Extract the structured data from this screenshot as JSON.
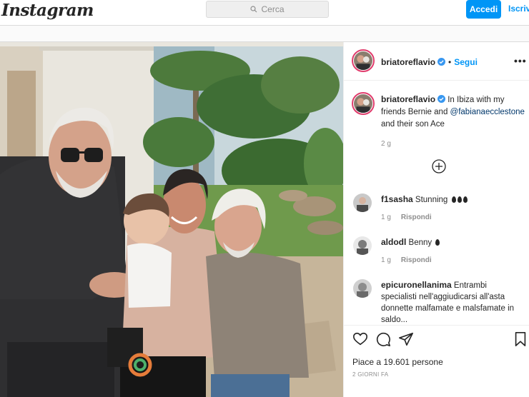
{
  "nav": {
    "logo": "Instagram",
    "search_placeholder": "Cerca",
    "login_label": "Accedi",
    "signup_label": "Iscriviti"
  },
  "post": {
    "author": "briatoreflavio",
    "dot": "•",
    "follow_label": "Segui",
    "more_label": "•••",
    "caption_text_before": "In Ibiza with my friends Bernie and ",
    "caption_tag": "@fabianaecclestone",
    "caption_text_after": " and their son Ace",
    "caption_age": "2 g",
    "comments": [
      {
        "user": "f1sasha",
        "text": "Stunning",
        "age": "1 g",
        "reply": "Rispondi"
      },
      {
        "user": "aldodl",
        "text": "Benny",
        "age": "1 g",
        "reply": "Rispondi"
      },
      {
        "user": "epicuronellanima",
        "text": "Entrambi specialisti nell'aggiudicarsi all'asta donnette malfamate e malsfamate in saldo...",
        "age": "",
        "reply": ""
      }
    ],
    "likes": "Piace a 19.601 persone",
    "date": "2 GIORNI FA"
  },
  "colors": {
    "accent": "#0095f6",
    "verified": "#3897f0",
    "ring": "#e03c6c"
  },
  "icons": [
    "search-icon",
    "verified-badge-icon",
    "more-options-icon",
    "load-more-comments-icon",
    "heart-icon",
    "comment-icon",
    "share-icon",
    "bookmark-icon"
  ]
}
